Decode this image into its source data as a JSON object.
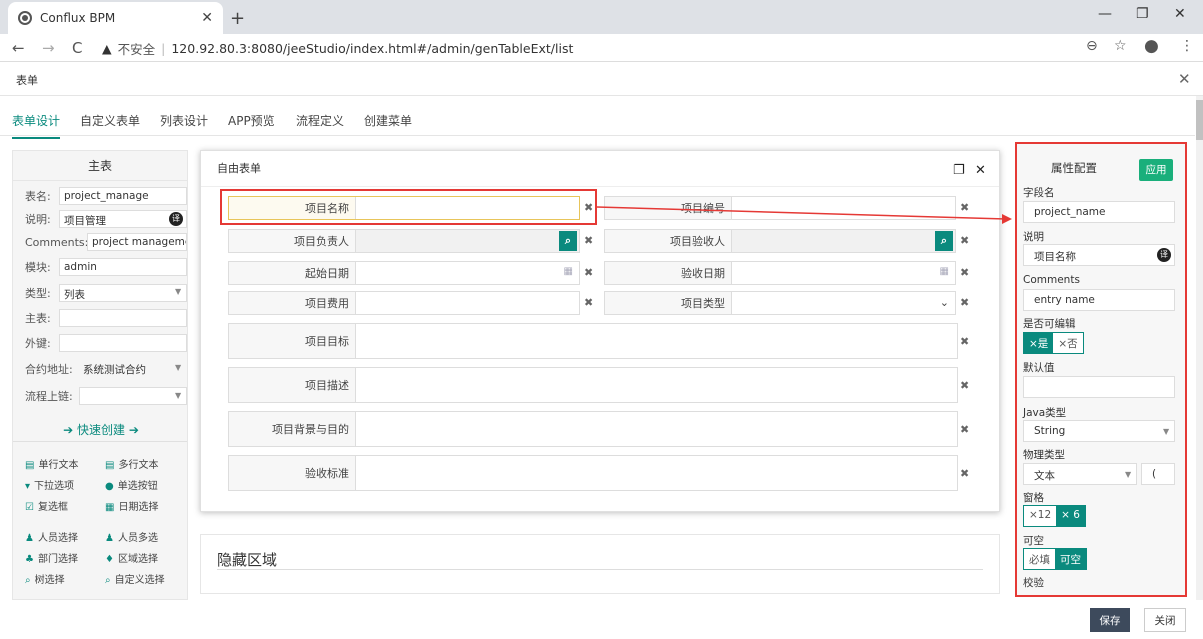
{
  "browser": {
    "tab_title": "Conflux BPM",
    "insecure_label": "不安全",
    "url": "120.92.80.3:8080/jeeStudio/index.html#/admin/genTableExt/list"
  },
  "app": {
    "header_title": "表单",
    "tabs": [
      "表单设计",
      "自定义表单",
      "列表设计",
      "APP预览",
      "流程定义",
      "创建菜单"
    ]
  },
  "left_panel": {
    "title": "主表",
    "fields": {
      "table_name_label": "表名:",
      "table_name": "project_manage",
      "desc_label": "说明:",
      "desc": "项目管理",
      "translate_badge": "译",
      "comments_label": "Comments:",
      "comments": "project manageme",
      "module_label": "模块:",
      "module": "admin",
      "type_label": "类型:",
      "type": "列表",
      "main_label": "主表:",
      "foreign_label": "外键:",
      "contract_label": "合约地址:",
      "contract": "系统测试合约",
      "flow_label": "流程上链:"
    },
    "quick_create": "快速创建",
    "tools": [
      "单行文本",
      "多行文本",
      "下拉选项",
      "单选按钮",
      "复选框",
      "日期选择",
      "人员选择",
      "人员多选",
      "部门选择",
      "区域选择",
      "树选择",
      "自定义选择"
    ]
  },
  "modal": {
    "title": "自由表单",
    "fields": {
      "name": "项目名称",
      "code": "项目编号",
      "owner": "项目负责人",
      "acceptor": "项目验收人",
      "start": "起始日期",
      "accept_date": "验收日期",
      "cost": "项目费用",
      "type": "项目类型",
      "goal": "项目目标",
      "desc": "项目描述",
      "background": "项目背景与目的",
      "standard": "验收标准"
    }
  },
  "hidden_area": {
    "title": "隐藏区域"
  },
  "props": {
    "title": "属性配置",
    "apply": "应用",
    "field_name_label": "字段名",
    "field_name": "project_name",
    "desc_label": "说明",
    "desc": "项目名称",
    "translate_badge": "译",
    "comments_label": "Comments",
    "comments": "entry name",
    "editable_label": "是否可编辑",
    "editable_yes": "×是",
    "editable_no": "×否",
    "default_label": "默认值",
    "java_type_label": "Java类型",
    "java_type": "String",
    "phys_type_label": "物理类型",
    "phys_type": "文本",
    "phys_len": "(",
    "grid_label": "窗格",
    "grid_12": "×12",
    "grid_6": "× 6",
    "nullable_label": "可空",
    "required": "必填",
    "nullable": "可空",
    "validate_label": "校验"
  },
  "footer": {
    "save": "保存",
    "close": "关闭"
  },
  "colors": {
    "accent": "#0a8a7e",
    "apply_green": "#1aaf7b",
    "annotation_red": "#e53935"
  }
}
